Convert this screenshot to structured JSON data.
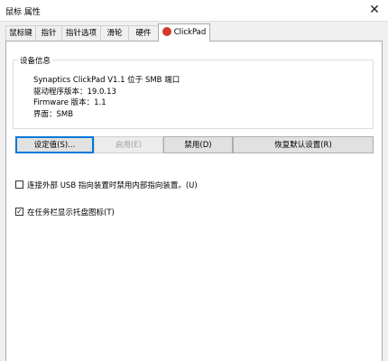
{
  "window": {
    "title": "鼠标 属性",
    "close_glyph": "✕"
  },
  "tabs": [
    {
      "label": "鼠标键"
    },
    {
      "label": "指针"
    },
    {
      "label": "指针选项"
    },
    {
      "label": "滑轮"
    },
    {
      "label": "硬件"
    },
    {
      "label": "ClickPad",
      "active": true,
      "icon": "synaptics-clickpad-icon"
    }
  ],
  "device_info": {
    "legend": "设备信息",
    "lines": [
      "Synaptics ClickPad V1.1 位于 SMB 端口",
      "驱动程序版本：19.0.13",
      "Firmware 版本：1.1",
      "界面：SMB"
    ]
  },
  "buttons": {
    "settings": "设定值(S)...",
    "enable": "启用(E)",
    "disable": "禁用(D)",
    "restore_defaults": "恢复默认设置(R)"
  },
  "options": [
    {
      "label": "连接外部 USB 指向装置时禁用内部指向装置。(U)",
      "checked": false
    },
    {
      "label": "在任务栏显示托盘图标(T)",
      "checked": true
    }
  ],
  "colors": {
    "accent": "#0078d7",
    "clickpad_icon": "#d23a2c"
  }
}
